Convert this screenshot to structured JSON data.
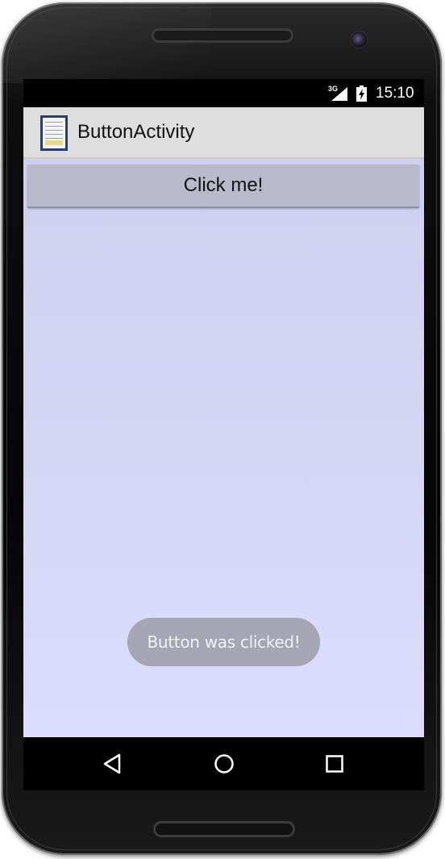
{
  "status_bar": {
    "network": "3G",
    "time": "15:10",
    "icons": [
      "signal-icon",
      "battery-charging-icon"
    ]
  },
  "action_bar": {
    "title": "ButtonActivity",
    "icon": "app-icon"
  },
  "main": {
    "button_label": "Click me!",
    "background_color": "#d4d6f4"
  },
  "toast": {
    "message": "Button was clicked!"
  },
  "nav_bar": {
    "icons": [
      "back-icon",
      "home-icon",
      "recents-icon"
    ]
  },
  "colors": {
    "action_bar": "#dedede",
    "button": "#b8b9cb",
    "toast": "#a5a5b3"
  }
}
